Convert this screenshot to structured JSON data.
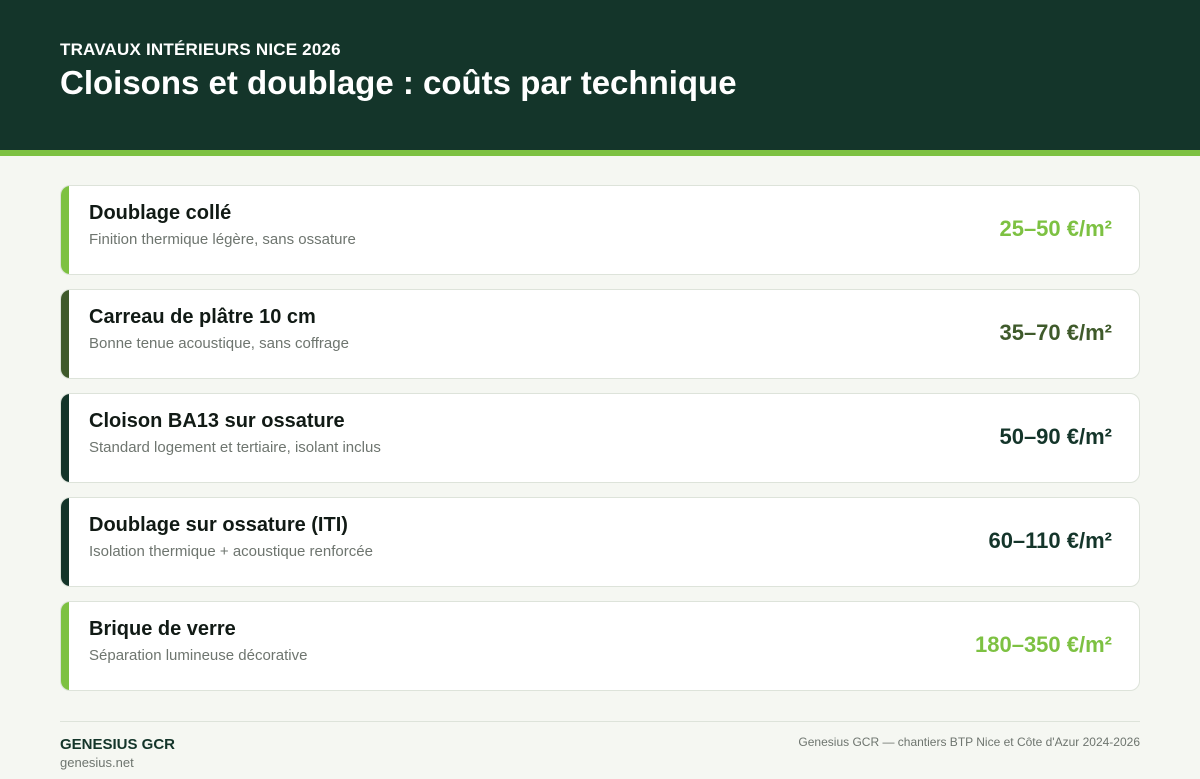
{
  "header": {
    "kicker": "TRAVAUX INTÉRIEURS NICE 2026",
    "title": "Cloisons et doublage : coûts par technique"
  },
  "colors": {
    "header_bg": "#14352a",
    "accent_green": "#7dc142",
    "olive": "#3f5a2b",
    "dark_green": "#14352a"
  },
  "items": [
    {
      "title": "Doublage collé",
      "subtitle": "Finition thermique légère, sans ossature",
      "price": "25–50 €/m²",
      "color": "#7dc142"
    },
    {
      "title": "Carreau de plâtre 10 cm",
      "subtitle": "Bonne tenue acoustique, sans coffrage",
      "price": "35–70 €/m²",
      "color": "#3f5a2b"
    },
    {
      "title": "Cloison BA13 sur ossature",
      "subtitle": "Standard logement et tertiaire, isolant inclus",
      "price": "50–90 €/m²",
      "color": "#14352a"
    },
    {
      "title": "Doublage sur ossature (ITI)",
      "subtitle": "Isolation thermique + acoustique renforcée",
      "price": "60–110 €/m²",
      "color": "#14352a"
    },
    {
      "title": "Brique de verre",
      "subtitle": "Séparation lumineuse décorative",
      "price": "180–350 €/m²",
      "color": "#7dc142"
    }
  ],
  "footer": {
    "brand": "GENESIUS GCR",
    "site": "genesius.net",
    "credit": "Genesius GCR — chantiers BTP Nice et Côte d'Azur 2024-2026"
  }
}
